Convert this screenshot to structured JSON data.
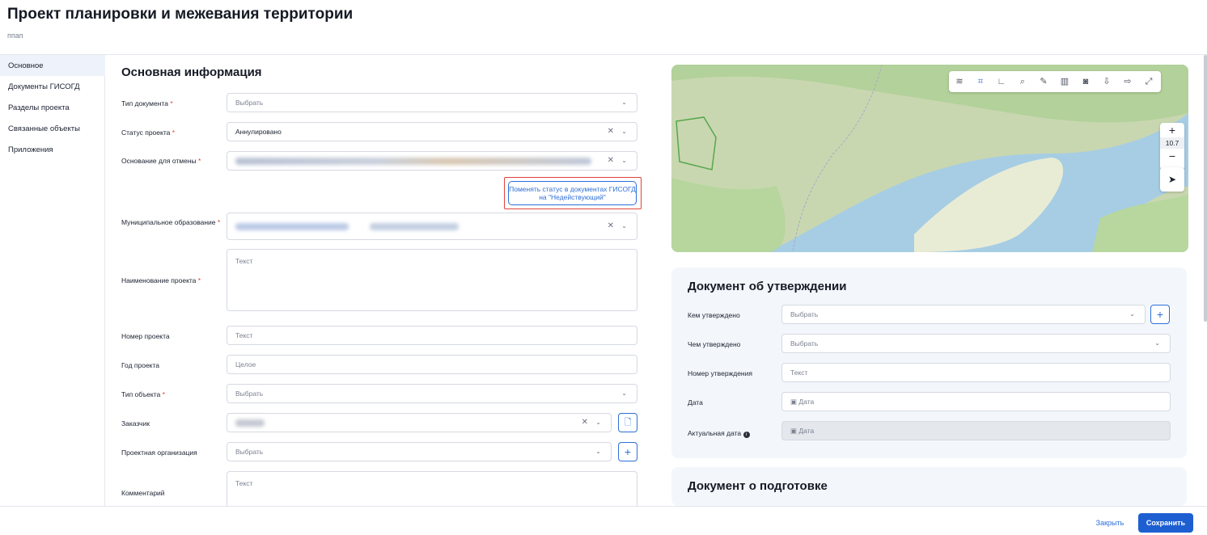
{
  "header": {
    "title": "Проект планировки и межевания территории",
    "subtitle": "ппап"
  },
  "sidebar": {
    "items": [
      {
        "label": "Основное",
        "active": true
      },
      {
        "label": "Документы ГИСОГД",
        "active": false
      },
      {
        "label": "Разделы проекта",
        "active": false
      },
      {
        "label": "Связанные объекты",
        "active": false
      },
      {
        "label": "Приложения",
        "active": false
      }
    ]
  },
  "main": {
    "section_title": "Основная информация",
    "fields": {
      "doc_type": {
        "label": "Тип документа",
        "required": "*",
        "value": "Выбрать"
      },
      "status": {
        "label": "Статус проекта",
        "required": "*",
        "value": "Аннулировано"
      },
      "cancel_reason": {
        "label": "Основание для отмены",
        "required": "*"
      },
      "status_button": "Поменять статус в документах ГИСОГД на \"Недействующий\"",
      "municipal": {
        "label": "Муниципальное образование",
        "required": "*"
      },
      "project_name": {
        "label": "Наименование проекта",
        "required": "*",
        "placeholder": "Текст"
      },
      "project_number": {
        "label": "Номер проекта",
        "placeholder": "Текст"
      },
      "project_year": {
        "label": "Год проекта",
        "placeholder": "Целое"
      },
      "object_type": {
        "label": "Тип объекта",
        "required": "*",
        "value": "Выбрать"
      },
      "customer": {
        "label": "Заказчик"
      },
      "design_org": {
        "label": "Проектная организация",
        "value": "Выбрать"
      },
      "comment": {
        "label": "Комментарий",
        "placeholder": "Текст"
      }
    }
  },
  "map": {
    "zoom": "10.7"
  },
  "approval": {
    "title": "Документ об утверждении",
    "approved_by": {
      "label": "Кем утверждено",
      "value": "Выбрать"
    },
    "approved_with": {
      "label": "Чем утверждено",
      "value": "Выбрать"
    },
    "approval_number": {
      "label": "Номер утверждения",
      "placeholder": "Текст"
    },
    "date": {
      "label": "Дата",
      "placeholder": "Дата"
    },
    "actual_date": {
      "label": "Актуальная дата",
      "placeholder": "Дата"
    }
  },
  "preparation": {
    "title": "Документ о подготовке"
  },
  "footer": {
    "close": "Закрыть",
    "save": "Сохранить"
  },
  "colors": {
    "primary": "#1d5fd1",
    "required": "#e0433b",
    "highlight": "#e0433b"
  },
  "icons": [
    "layers-icon",
    "polygon-icon",
    "ruler-icon",
    "search-icon",
    "pencil-icon",
    "trash-icon",
    "camera-icon",
    "import-icon",
    "export-icon",
    "fullscreen-icon",
    "plus-icon",
    "minus-icon",
    "navigate-icon",
    "calendar-icon",
    "info-icon",
    "chevron-down-icon",
    "clear-icon",
    "document-icon"
  ]
}
